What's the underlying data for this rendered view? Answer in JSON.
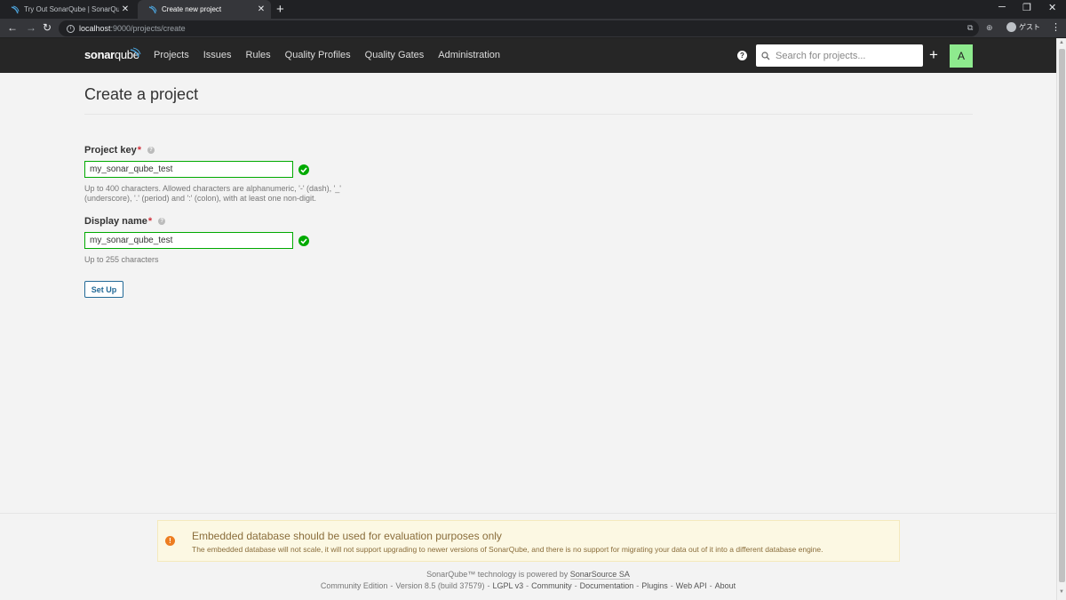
{
  "browser": {
    "tabs": [
      {
        "title": "Try Out SonarQube | SonarQube",
        "active": false
      },
      {
        "title": "Create new project",
        "active": true
      }
    ],
    "url_host": "localhost",
    "url_path": ":9000/projects/create",
    "profile_label": "ゲスト"
  },
  "navbar": {
    "logo_bold": "sonar",
    "logo_light": "qube",
    "items": [
      "Projects",
      "Issues",
      "Rules",
      "Quality Profiles",
      "Quality Gates",
      "Administration"
    ],
    "search_placeholder": "Search for projects...",
    "avatar_letter": "A"
  },
  "page": {
    "title": "Create a project",
    "project_key": {
      "label": "Project key",
      "required_mark": "*",
      "value": "my_sonar_qube_test",
      "help_line1": "Up to 400 characters. Allowed characters are alphanumeric, '-' (dash), '_'",
      "help_line2": "(underscore), '.' (period) and ':' (colon), with at least one non-digit."
    },
    "display_name": {
      "label": "Display name",
      "required_mark": "*",
      "value": "my_sonar_qube_test",
      "help": "Up to 255 characters"
    },
    "setup_label": "Set Up"
  },
  "footer": {
    "warning_title": "Embedded database should be used for evaluation purposes only",
    "warning_desc": "The embedded database will not scale, it will not support upgrading to newer versions of SonarQube, and there is no support for migrating your data out of it into a different database engine.",
    "powered_prefix": "SonarQube™ technology is powered by ",
    "powered_link": "SonarSource SA",
    "edition": "Community Edition",
    "version": "Version 8.5 (build 37579)",
    "license": "LGPL v3",
    "links": [
      "Community",
      "Documentation",
      "Plugins",
      "Web API",
      "About"
    ]
  },
  "colors": {
    "navbar_bg": "#262626",
    "valid_green": "#00aa00",
    "link_blue": "#236a97",
    "warning_bg": "#fcf8e3",
    "warning_orange": "#ed7d20"
  }
}
